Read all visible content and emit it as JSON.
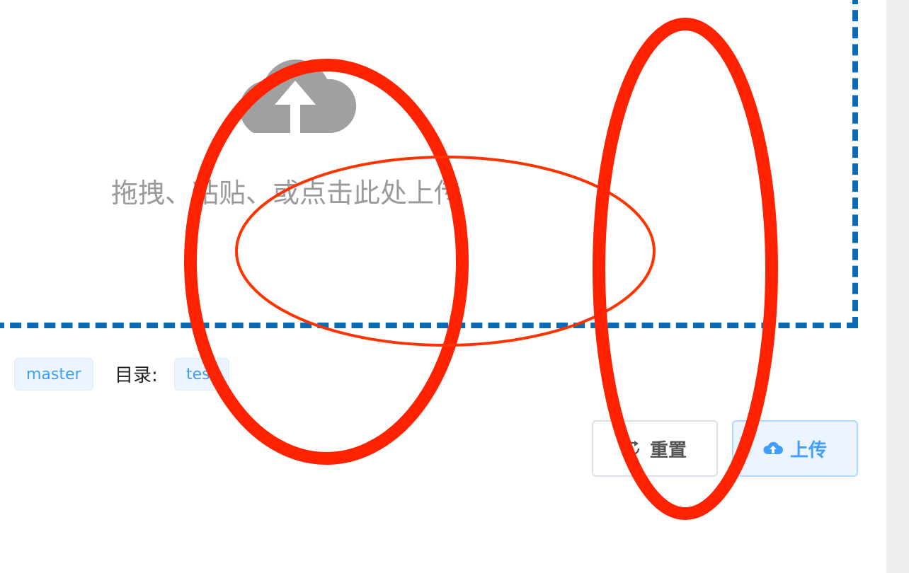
{
  "upload": {
    "prompt": "拖拽、粘贴、或点击此处上传",
    "icon": "cloud-upload-icon"
  },
  "meta": {
    "branch": "master",
    "dir_label": "目录:",
    "dir_value": "test"
  },
  "actions": {
    "reset_label": "重置",
    "reset_icon": "refresh-icon",
    "upload_label": "上传",
    "upload_icon": "cloud-upload-icon"
  },
  "colors": {
    "dropzone_border": "#0a6ab3",
    "annotation": "#ff2200",
    "primary": "#409eff",
    "icon_gray": "#9e9e9e"
  },
  "annotations": {
    "type": "red-ellipses",
    "count": 3
  }
}
